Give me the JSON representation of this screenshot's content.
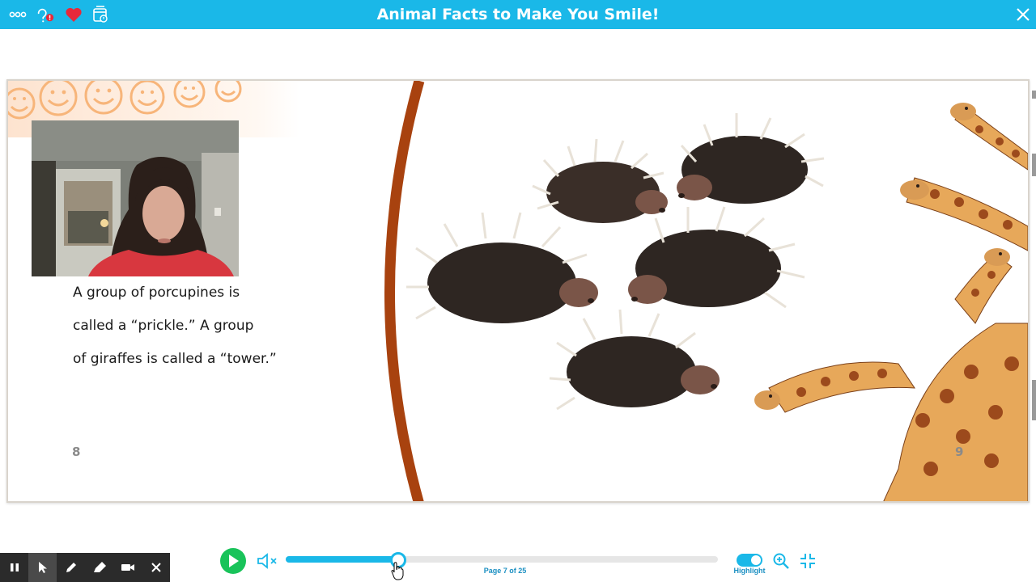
{
  "header": {
    "title": "Animal Facts to Make You Smile!",
    "background_color": "#1ab8e8",
    "left_icons": [
      "more-dots-icon",
      "help-icon",
      "favorite-heart-icon",
      "assignment-icon"
    ],
    "right_icons": [
      "close-icon"
    ]
  },
  "book": {
    "left_page": {
      "text_lines": [
        "A group of porcupines is",
        "called a “prickle.” A group",
        "of giraffes is called a “tower.”"
      ],
      "page_number": "8"
    },
    "right_page": {
      "page_number": "9"
    }
  },
  "player": {
    "page_label": "Page 7 of 25",
    "progress": 0.26,
    "highlight_label": "Highlight",
    "highlight_on": true,
    "accent_color": "#1ab8e8",
    "play_color": "#19c35a"
  },
  "recording_toolbar": {
    "buttons": [
      "pause-icon",
      "pointer-icon",
      "pen-icon",
      "highlighter-icon",
      "camera-icon",
      "close-icon"
    ]
  }
}
